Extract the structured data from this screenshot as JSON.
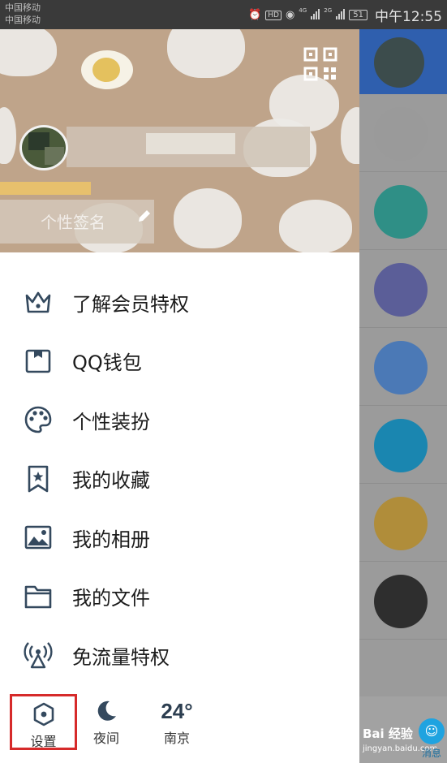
{
  "status_bar": {
    "carrier_1": "中国移动",
    "carrier_2": "中国移动",
    "hd": "HD",
    "net_1": "4G",
    "net_2": "2G",
    "battery": "51",
    "time": "中午12:55"
  },
  "header": {
    "signature_partial": "个性签名"
  },
  "menu": {
    "items": [
      {
        "label": "了解会员特权",
        "icon": "crown-icon"
      },
      {
        "label": "QQ钱包",
        "icon": "wallet-icon"
      },
      {
        "label": "个性装扮",
        "icon": "palette-icon"
      },
      {
        "label": "我的收藏",
        "icon": "bookmark-star-icon"
      },
      {
        "label": "我的相册",
        "icon": "photo-icon"
      },
      {
        "label": "我的文件",
        "icon": "folder-icon"
      },
      {
        "label": "免流量特权",
        "icon": "antenna-icon"
      }
    ]
  },
  "footer": {
    "settings_label": "设置",
    "night_label": "夜间",
    "temperature": "24°",
    "city": "南京"
  },
  "background": {
    "messages_tab_label": "消息",
    "watermark_text": "Bai 经验",
    "watermark_url": "jingyan.baidu.com"
  },
  "colors": {
    "accent_highlight": "#d62a2a",
    "icon_color": "#34495e",
    "header_bg": "#bfa48a"
  }
}
